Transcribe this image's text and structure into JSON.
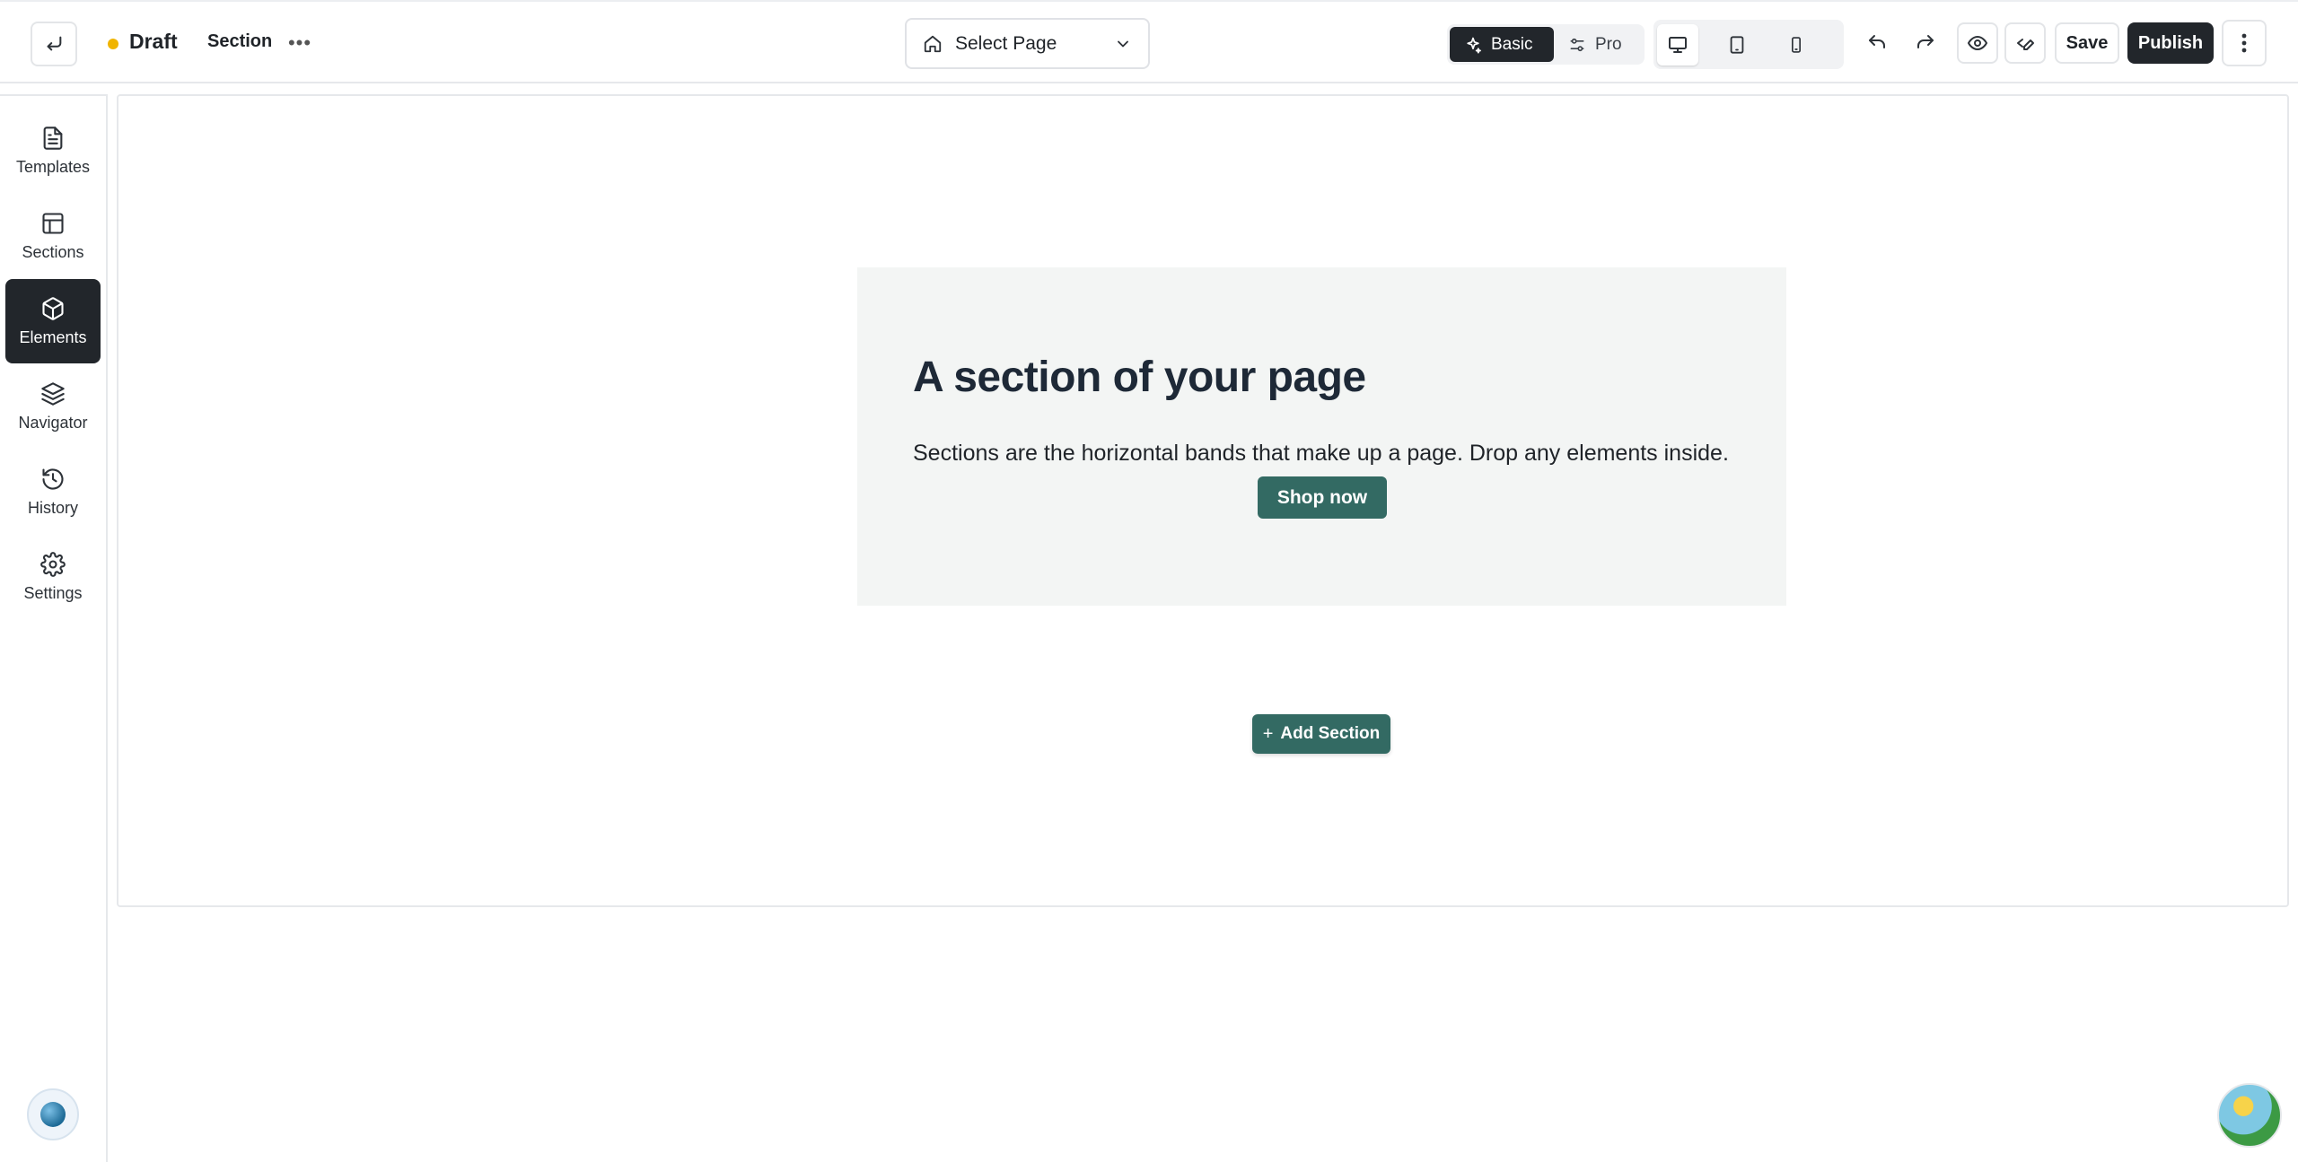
{
  "header": {
    "status": "Draft",
    "context": "Section",
    "page_select": {
      "label": "Select Page"
    },
    "modes": {
      "basic": "Basic",
      "pro": "Pro",
      "active": "Basic"
    },
    "devices": [
      "desktop",
      "tablet",
      "mobile"
    ],
    "active_device": "desktop",
    "save_label": "Save",
    "publish_label": "Publish"
  },
  "sidebar": {
    "items": [
      {
        "label": "Templates",
        "icon": "file-text-icon"
      },
      {
        "label": "Sections",
        "icon": "layout-icon"
      },
      {
        "label": "Elements",
        "icon": "box-icon",
        "active": true
      },
      {
        "label": "Navigator",
        "icon": "layers-icon"
      },
      {
        "label": "History",
        "icon": "history-icon"
      },
      {
        "label": "Settings",
        "icon": "gear-icon"
      }
    ]
  },
  "canvas": {
    "hero": {
      "title": "A section of your page",
      "description": "Sections are the horizontal bands that make up a page. Drop any elements inside.",
      "button": "Shop now"
    },
    "add_section": "Add Section"
  },
  "colors": {
    "accent": "#336a63",
    "dark": "#22262b",
    "status_dot": "#f0b400",
    "hero_bg": "#f3f5f4"
  }
}
